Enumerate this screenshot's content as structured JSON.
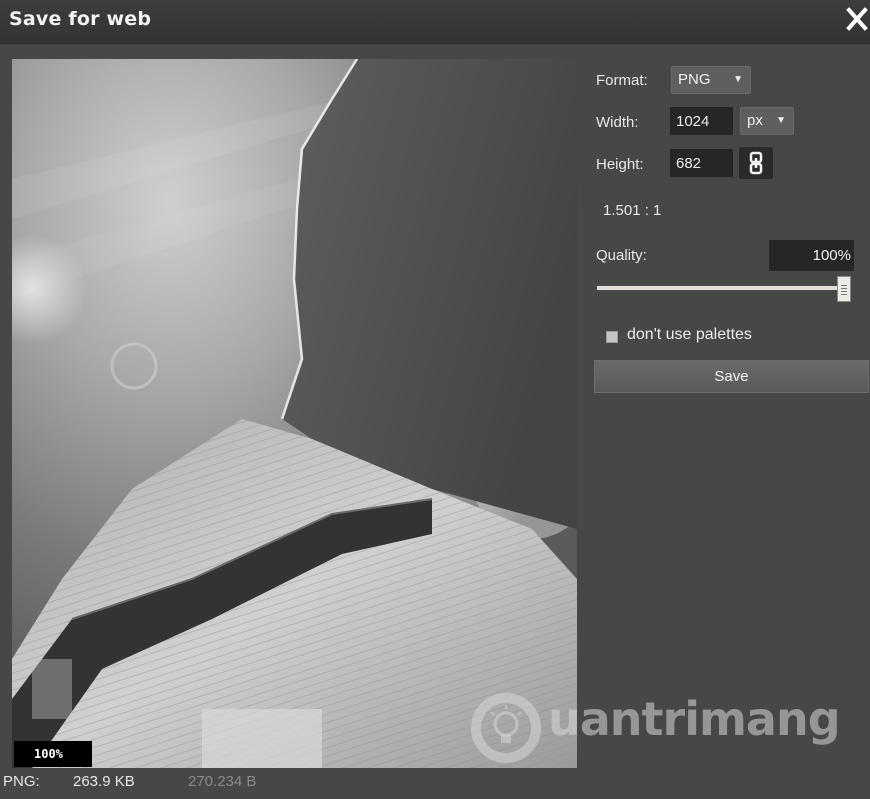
{
  "window": {
    "title": "Save for web",
    "close_icon": "close-icon"
  },
  "preview": {
    "zoom": "100%",
    "watermark_text": "uantrimang",
    "watermark_icon": "lightbulb-logo-icon"
  },
  "footer": {
    "format": "PNG:",
    "file_size": "263.9 KB",
    "original_size": "270.234 B"
  },
  "settings": {
    "format_label": "Format:",
    "format_value": "PNG",
    "width_label": "Width:",
    "width_value": "1024",
    "unit_value": "px",
    "height_label": "Height:",
    "height_value": "682",
    "link_icon": "chain-link-icon",
    "ratio": "1.501 : 1",
    "quality_label": "Quality:",
    "quality_value": "100%",
    "quality_level": 1.0,
    "palette_label": "don't use palettes",
    "palette_checked": false,
    "save_label": "Save"
  },
  "colors": {
    "panel_bg": "#474747",
    "titlebar_bg": "#383838",
    "input_bg": "#262626",
    "button_bg": "#5f5f5f"
  }
}
